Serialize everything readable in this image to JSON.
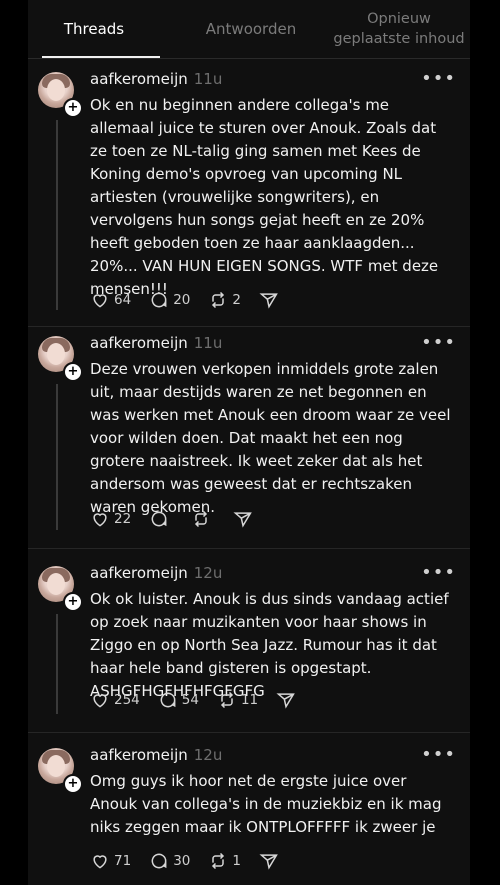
{
  "tabs": [
    {
      "label": "Threads",
      "active": true
    },
    {
      "label": "Antwoorden",
      "active": false
    },
    {
      "label": "Opnieuw geplaatste inhoud",
      "active": false
    }
  ],
  "posts": [
    {
      "username": "aafkeromeijn",
      "time": "11u",
      "text": "Ok en nu beginnen andere collega's me allemaal juice te sturen over Anouk. Zoals dat ze toen ze NL-talig ging samen met Kees de Koning demo's opvroeg van upcoming NL artiesten (vrouwelijke songwriters), en vervolgens hun songs gejat heeft en ze 20% heeft geboden toen ze haar aanklaagden... 20%... VAN HUN EIGEN SONGS. WTF met deze mensen!!!",
      "likes": "64",
      "replies": "20",
      "reposts": "2"
    },
    {
      "username": "aafkeromeijn",
      "time": "11u",
      "text": "Deze vrouwen verkopen inmiddels grote zalen uit, maar destijds waren ze net begonnen en was werken met Anouk een droom waar ze veel voor wilden doen. Dat maakt het een nog grotere naaistreek. Ik weet zeker dat als het andersom was geweest dat er rechtszaken waren gekomen.",
      "likes": "22",
      "replies": "",
      "reposts": ""
    },
    {
      "username": "aafkeromeijn",
      "time": "12u",
      "text": "Ok ok luister. Anouk is dus sinds vandaag actief op zoek naar muzikanten voor haar shows in Ziggo en op North Sea Jazz. Rumour has it dat haar hele band gisteren is opgestapt. ASHGFHGFHFHFGFGFG",
      "likes": "254",
      "replies": "54",
      "reposts": "11"
    },
    {
      "username": "aafkeromeijn",
      "time": "12u",
      "text": "Omg guys ik hoor net de ergste juice over Anouk van collega's in de muziekbiz en ik mag niks zeggen maar ik ONTPLOFFFFF ik zweer je",
      "likes": "71",
      "replies": "30",
      "reposts": "1"
    }
  ],
  "more_label": "•••",
  "plus_label": "+",
  "icons": [
    "heart-icon",
    "comment-icon",
    "repost-icon",
    "share-icon",
    "more-icon",
    "plus-icon"
  ]
}
